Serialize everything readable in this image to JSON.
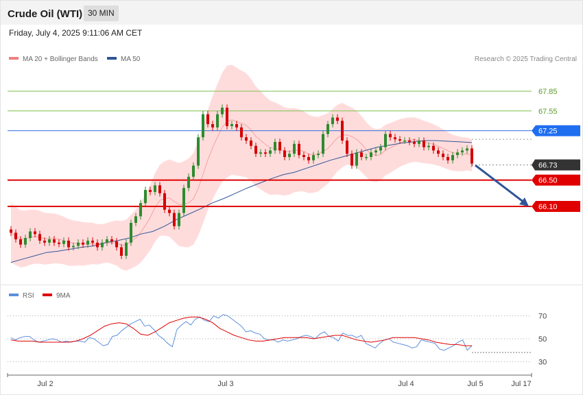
{
  "header": {
    "title": "Crude Oil (WTI)",
    "interval": "30 MIN"
  },
  "datetime": "Friday, July 4, 2025 9:11:06 AM CET",
  "legend": {
    "bollinger": {
      "label": "MA 20 + Bollinger Bands",
      "color": "#f08080"
    },
    "ma50": {
      "label": "MA 50",
      "color": "#2f5597"
    }
  },
  "copyright": "Research © 2025 Trading Central",
  "rsi_legend": {
    "rsi": {
      "label": "RSI",
      "color": "#5b8fdc"
    },
    "ma9": {
      "label": "9MA",
      "color": "#e00000"
    }
  },
  "levels": [
    {
      "value": 67.85,
      "label": "67.85",
      "kind": "green"
    },
    {
      "value": 67.55,
      "label": "67.55",
      "kind": "green"
    },
    {
      "value": 67.25,
      "label": "67.25",
      "kind": "blue"
    },
    {
      "value": 66.73,
      "label": "66.73",
      "kind": "last"
    },
    {
      "value": 66.5,
      "label": "66.50",
      "kind": "red"
    },
    {
      "value": 66.1,
      "label": "66.10",
      "kind": "red"
    }
  ],
  "rsi_levels": [
    "70",
    "50",
    "30"
  ],
  "x_labels": [
    "Jul 2",
    "Jul 3",
    "Jul 4",
    "Jul 5",
    "Jul 17"
  ],
  "colors": {
    "up": "#2e8b2e",
    "down": "#d40000",
    "band": "#ffd6d6",
    "green_level": "#7cbf4a",
    "blue_level": "#2f6fe0",
    "red_level": "#e00000",
    "last": "#333333",
    "arrow": "#2f5597"
  },
  "chart_data": {
    "type": "candlestick",
    "y_range": [
      65.0,
      68.1
    ],
    "close_series": [
      65.7,
      65.6,
      65.52,
      65.62,
      65.72,
      65.68,
      65.58,
      65.55,
      65.6,
      65.55,
      65.53,
      65.58,
      65.48,
      65.5,
      65.55,
      65.52,
      65.58,
      65.55,
      65.48,
      65.55,
      65.6,
      65.57,
      65.48,
      65.35,
      65.55,
      65.85,
      65.95,
      66.15,
      66.35,
      66.32,
      66.42,
      66.3,
      66.05,
      66.0,
      65.8,
      66.0,
      66.38,
      66.55,
      66.72,
      67.15,
      67.5,
      67.35,
      67.3,
      67.5,
      67.6,
      67.32,
      67.35,
      67.3,
      67.15,
      67.1,
      67.02,
      66.9,
      66.92,
      66.9,
      66.95,
      67.08,
      66.95,
      66.85,
      66.9,
      67.05,
      66.88,
      66.85,
      66.8,
      66.88,
      66.9,
      67.2,
      67.35,
      67.45,
      67.4,
      67.1,
      66.9,
      66.72,
      66.92,
      66.85,
      66.85,
      66.92,
      66.95,
      67.0,
      67.2,
      67.15,
      67.12,
      67.1,
      67.1,
      67.08,
      67.05,
      67.1,
      67.0,
      67.02,
      66.95,
      66.9,
      66.85,
      66.8,
      66.88,
      66.92,
      66.95,
      66.98,
      66.75
    ],
    "ma50_series": [
      65.25,
      65.3,
      65.35,
      65.4,
      65.42,
      65.45,
      65.48,
      65.5,
      65.55,
      65.58,
      65.62,
      65.68,
      65.72,
      65.8,
      65.9,
      65.98,
      66.06,
      66.15,
      66.22,
      66.3,
      66.38,
      66.45,
      66.52,
      66.58,
      66.62,
      66.68,
      66.74,
      66.8,
      66.85,
      66.9,
      66.95,
      67.0,
      67.03,
      67.06,
      67.08,
      67.1,
      67.1,
      67.09,
      67.08,
      67.07
    ],
    "rsi_series": [
      51,
      49,
      51,
      52,
      52,
      49,
      47,
      48,
      49,
      50,
      49,
      47,
      48,
      47,
      48,
      48,
      47,
      51,
      50,
      47,
      44,
      45,
      52,
      53,
      57,
      60,
      63,
      65,
      67,
      61,
      62,
      58,
      53,
      50,
      46,
      43,
      58,
      62,
      65,
      62,
      67,
      69,
      66,
      65,
      70,
      68,
      71,
      70,
      67,
      64,
      61,
      56,
      57,
      55,
      54,
      50,
      49,
      49,
      47,
      49,
      48,
      49,
      50,
      52,
      53,
      52,
      50,
      54,
      56,
      52,
      51,
      48,
      55,
      53,
      53,
      51,
      53,
      46,
      44,
      42,
      46,
      49,
      50,
      47,
      46,
      45,
      44,
      42,
      43,
      49,
      48,
      47,
      46,
      41,
      40,
      42,
      44,
      47,
      49,
      40,
      44
    ],
    "rsi_ma_series": [
      49,
      48,
      48,
      48,
      47,
      47,
      47,
      47,
      47,
      48,
      50,
      53,
      57,
      61,
      63,
      64,
      63,
      59,
      54,
      53,
      56,
      60,
      64,
      66,
      68,
      69,
      69,
      67,
      64,
      59,
      56,
      53,
      51,
      49,
      48,
      48,
      49,
      50,
      51,
      51,
      51,
      51,
      50,
      51,
      52,
      53,
      53,
      51,
      49,
      48,
      47,
      48,
      49,
      51,
      51,
      51,
      51,
      50,
      49,
      47,
      46,
      45,
      45,
      44,
      44
    ],
    "rsi_range": [
      20,
      80
    ]
  }
}
